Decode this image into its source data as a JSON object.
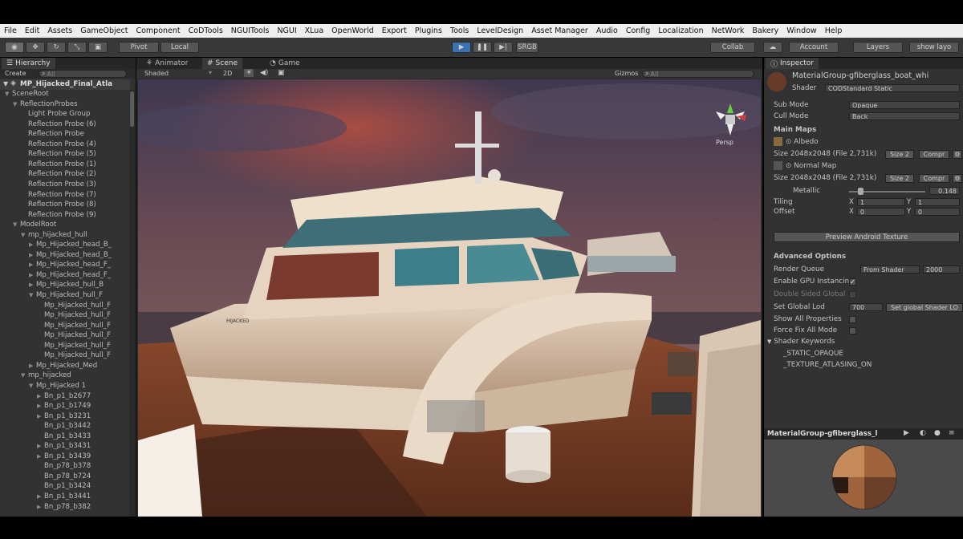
{
  "menu": [
    "File",
    "Edit",
    "Assets",
    "GameObject",
    "Component",
    "CoDTools",
    "NGUITools",
    "NGUI",
    "XLua",
    "OpenWorld",
    "Export",
    "Plugins",
    "Tools",
    "LevelDesign",
    "Asset Manager",
    "Audio",
    "Config",
    "Localization",
    "NetWork",
    "Bakery",
    "Window",
    "Help"
  ],
  "toolbar": {
    "pivot": "Pivot",
    "local": "Local",
    "srgb": "SRGB",
    "collab": "Collab",
    "account": "Account",
    "layers": "Layers",
    "layout": "show layo"
  },
  "hierarchy": {
    "tab": "Hierarchy",
    "create": "Create",
    "search_placeholder": "All",
    "scene_name": "MP_Hijacked_Final_Atla",
    "rows": [
      {
        "label": "SceneRoot",
        "indent": 1,
        "arrow": "▼"
      },
      {
        "label": "ReflectionProbes",
        "indent": 2,
        "arrow": "▼"
      },
      {
        "label": "Light Probe Group",
        "indent": 3,
        "arrow": ""
      },
      {
        "label": "Reflection Probe (6)",
        "indent": 3,
        "arrow": ""
      },
      {
        "label": "Reflection Probe",
        "indent": 3,
        "arrow": ""
      },
      {
        "label": "Reflection Probe (4)",
        "indent": 3,
        "arrow": ""
      },
      {
        "label": "Reflection Probe (5)",
        "indent": 3,
        "arrow": ""
      },
      {
        "label": "Reflection Probe (1)",
        "indent": 3,
        "arrow": ""
      },
      {
        "label": "Reflection Probe (2)",
        "indent": 3,
        "arrow": ""
      },
      {
        "label": "Reflection Probe (3)",
        "indent": 3,
        "arrow": ""
      },
      {
        "label": "Reflection Probe (7)",
        "indent": 3,
        "arrow": ""
      },
      {
        "label": "Reflection Probe (8)",
        "indent": 3,
        "arrow": ""
      },
      {
        "label": "Reflection Probe (9)",
        "indent": 3,
        "arrow": ""
      },
      {
        "label": "ModelRoot",
        "indent": 2,
        "arrow": "▼"
      },
      {
        "label": "mp_hijacked_hull",
        "indent": 3,
        "arrow": "▼"
      },
      {
        "label": "Mp_Hijacked_head_B_",
        "indent": 4,
        "arrow": "▶"
      },
      {
        "label": "Mp_Hijacked_head_B_",
        "indent": 4,
        "arrow": "▶"
      },
      {
        "label": "Mp_Hijacked_head_F_",
        "indent": 4,
        "arrow": "▶"
      },
      {
        "label": "Mp_Hijacked_head_F_",
        "indent": 4,
        "arrow": "▶"
      },
      {
        "label": "Mp_Hijacked_hull_B",
        "indent": 4,
        "arrow": "▶"
      },
      {
        "label": "Mp_Hijacked_hull_F",
        "indent": 4,
        "arrow": "▼"
      },
      {
        "label": "Mp_Hijacked_hull_F",
        "indent": 5,
        "arrow": ""
      },
      {
        "label": "Mp_Hijacked_hull_F",
        "indent": 5,
        "arrow": ""
      },
      {
        "label": "Mp_Hijacked_hull_F",
        "indent": 5,
        "arrow": ""
      },
      {
        "label": "Mp_Hijacked_hull_F",
        "indent": 5,
        "arrow": ""
      },
      {
        "label": "Mp_Hijacked_hull_F",
        "indent": 5,
        "arrow": ""
      },
      {
        "label": "Mp_Hijacked_hull_F",
        "indent": 5,
        "arrow": ""
      },
      {
        "label": "Mp_Hijacked_Med",
        "indent": 4,
        "arrow": "▶"
      },
      {
        "label": "mp_hijacked",
        "indent": 3,
        "arrow": "▼"
      },
      {
        "label": "Mp_Hijacked 1",
        "indent": 4,
        "arrow": "▼"
      },
      {
        "label": "Bn_p1_b2677",
        "indent": 5,
        "arrow": "▶"
      },
      {
        "label": "Bn_p1_b1749",
        "indent": 5,
        "arrow": "▶"
      },
      {
        "label": "Bn_p1_b3231",
        "indent": 5,
        "arrow": "▶"
      },
      {
        "label": "Bn_p1_b3442",
        "indent": 5,
        "arrow": ""
      },
      {
        "label": "Bn_p1_b3433",
        "indent": 5,
        "arrow": ""
      },
      {
        "label": "Bn_p1_b3431",
        "indent": 5,
        "arrow": "▶"
      },
      {
        "label": "Bn_p1_b3439",
        "indent": 5,
        "arrow": "▶"
      },
      {
        "label": "Bn_p78_b378",
        "indent": 5,
        "arrow": ""
      },
      {
        "label": "Bn_p78_b724",
        "indent": 5,
        "arrow": ""
      },
      {
        "label": "Bn_p1_b3424",
        "indent": 5,
        "arrow": ""
      },
      {
        "label": "Bn_p1_b3441",
        "indent": 5,
        "arrow": "▶"
      },
      {
        "label": "Bn_p78_b382",
        "indent": 5,
        "arrow": "▶"
      }
    ]
  },
  "scene": {
    "tabs": [
      "Animator",
      "Scene",
      "Game"
    ],
    "shading": "Shaded",
    "mode2d": "2D",
    "gizmos": "Gizmos",
    "search_placeholder": "All",
    "persp": "Persp",
    "sign_text": "HIJACKED"
  },
  "inspector": {
    "tab": "Inspector",
    "material_name": "MaterialGroup-gfiberglass_boat_whi",
    "shader_label": "Shader",
    "shader_value": "CODStandard Static",
    "sub_mode_label": "Sub Mode",
    "sub_mode_value": "Opaque",
    "cull_mode_label": "Cull Mode",
    "cull_mode_value": "Back",
    "main_maps": "Main Maps",
    "albedo": "Albedo",
    "size1": "Size 2048x2048  (File 2,731k)",
    "size_btn": "Size 2",
    "compr_btn": "Compr",
    "normal_map": "Normal Map",
    "size2": "Size 2048x2048  (File 2,731k)",
    "metallic_label": "Metallic",
    "metallic_value": "0.148",
    "metallic_fraction": 0.148,
    "tiling_label": "Tiling",
    "offset_label": "Offset",
    "tiling_x": "1",
    "tiling_y": "1",
    "offset_x": "0",
    "offset_y": "0",
    "x_label": "X",
    "y_label": "Y",
    "preview_android": "Preview Android Texture",
    "advanced_options": "Advanced Options",
    "render_queue_label": "Render Queue",
    "render_queue_mode": "From Shader",
    "render_queue_value": "2000",
    "gpu_instancing_label": "Enable GPU Instancin",
    "gpu_instancing_checked": "✓",
    "double_sided_label": "Double Sided Global",
    "set_global_lod_label": "Set Global Lod",
    "set_global_lod_value": "700",
    "set_global_shader_btn": "Set global Shader LO",
    "show_all_properties": "Show All Properties",
    "force_fix": "Force Fix All Mode",
    "shader_keywords": "Shader Keywords",
    "keywords": [
      "_STATIC_OPAQUE",
      "_TEXTURE_ATLASING_ON"
    ],
    "preview_title": "MaterialGroup-gfiberglass_l"
  },
  "colors": {
    "accent": "#3a72b0",
    "panel": "#323232",
    "menubar": "#eeeeee"
  }
}
